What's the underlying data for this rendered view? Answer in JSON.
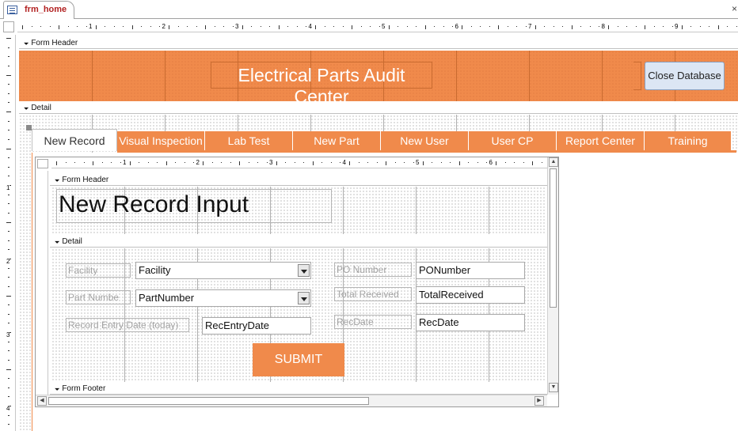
{
  "document_tab": {
    "label": "frm_home",
    "close_glyph": "×"
  },
  "ruler": {
    "top_numbers": [
      "1",
      "2",
      "3",
      "4",
      "5",
      "6",
      "7",
      "8",
      "9"
    ],
    "left_numbers": [
      "1",
      "2",
      "3",
      "4"
    ],
    "sub_top_numbers": [
      "1",
      "2",
      "3",
      "4",
      "5",
      "6"
    ]
  },
  "sections": {
    "form_header": "Form Header",
    "detail": "Detail"
  },
  "header": {
    "title": "Electrical Parts Audit Center",
    "close_button": "Close Database"
  },
  "nav_tabs": [
    {
      "label": "New Record",
      "active": true
    },
    {
      "label": "Visual Inspection",
      "active": false
    },
    {
      "label": "Lab Test",
      "active": false
    },
    {
      "label": "New Part",
      "active": false
    },
    {
      "label": "New User",
      "active": false
    },
    {
      "label": "User CP",
      "active": false
    },
    {
      "label": "Report Center",
      "active": false
    },
    {
      "label": "Training",
      "active": false
    }
  ],
  "subform": {
    "sections": {
      "form_header": "Form Header",
      "detail": "Detail",
      "form_footer": "Form Footer"
    },
    "title": "New Record Input",
    "fields": {
      "facility_label": "Facility",
      "facility_value": "Facility",
      "partnumber_label": "Part Numbe",
      "partnumber_value": "PartNumber",
      "recentry_label": "Record Entry Date (today)",
      "recentry_value": "RecEntryDate",
      "ponumber_label": "PO Number",
      "ponumber_value": "PONumber",
      "totalreceived_label": "Total Received",
      "totalreceived_value": "TotalReceived",
      "recdate_label": "RecDate",
      "recdate_value": "RecDate"
    },
    "submit": "SUBMIT"
  },
  "colors": {
    "accent": "#f08a4b",
    "button_face": "#dce6f4"
  }
}
